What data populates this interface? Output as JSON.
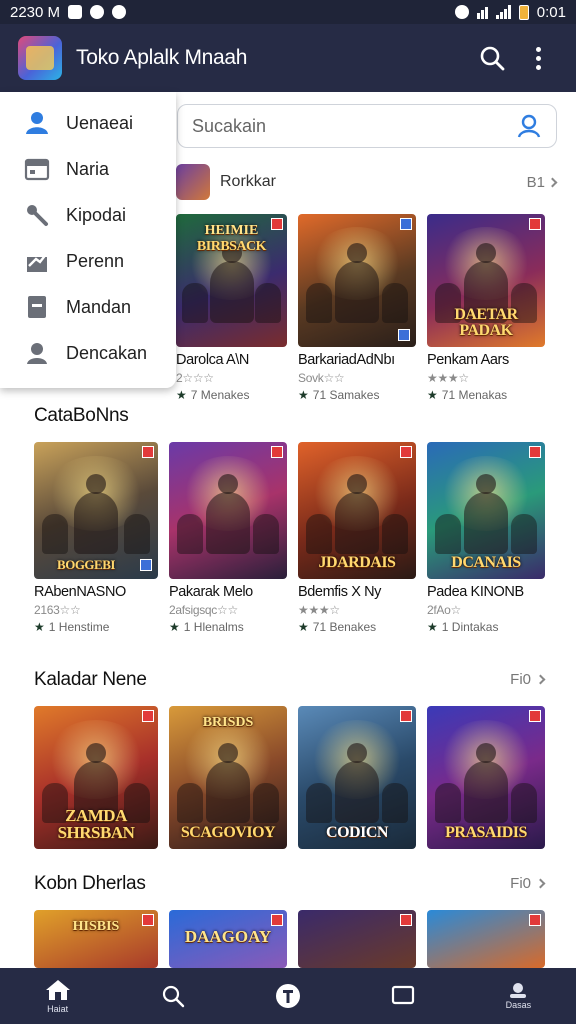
{
  "status": {
    "time": "2230 M",
    "right_time": "0:01"
  },
  "app": {
    "title": "Toko Aplalk Mnaah"
  },
  "colors": {
    "appbar": "#262b45",
    "accent": "#2f7de0"
  },
  "drawer": {
    "items": [
      {
        "label": "Uenaeai",
        "icon": "user-icon"
      },
      {
        "label": "Naria",
        "icon": "calendar-icon"
      },
      {
        "label": "Kipodai",
        "icon": "wrench-icon"
      },
      {
        "label": "Perenn",
        "icon": "chart-icon"
      },
      {
        "label": "Mandan",
        "icon": "document-icon"
      },
      {
        "label": "Dencakan",
        "icon": "person-icon"
      }
    ]
  },
  "search": {
    "placeholder": "Sucakain"
  },
  "featured": {
    "label": "Rorkkar",
    "more": "B1"
  },
  "top_cards": [
    {
      "name": "Darolca A\\N",
      "stars": "2☆☆☆",
      "meta": "7 Menakes",
      "logo": "BIRBSACK",
      "logo_top": "HEIMIE"
    },
    {
      "name": "BarkariadAdNbı",
      "stars": "Sovk☆☆",
      "meta": "71 Samakes",
      "logo": ""
    },
    {
      "name": "Penkam Aars",
      "stars": "★★★☆",
      "meta": "71 Menakas",
      "logo": "DAETAR PADAK",
      "logo_top": ""
    }
  ],
  "sections": [
    {
      "title": "CataBoNns",
      "more": ""
    },
    {
      "title": "Kaladar Nene",
      "more": "Fi0"
    },
    {
      "title": "Kobn Dherlas",
      "more": "Fi0"
    }
  ],
  "cat_cards": [
    {
      "name": "RAbenNASNO",
      "stars": "2163☆☆",
      "meta": "1 Henstime",
      "logo": "BOGGEBI"
    },
    {
      "name": "Pakarak Melo",
      "stars": "2afsigsqc☆☆",
      "meta": "1 Hlenalms",
      "logo": ""
    },
    {
      "name": "Bdemfis X Ny",
      "stars": "★★★☆",
      "meta": "71 Benakes",
      "logo": "JDARDAIS"
    },
    {
      "name": "Padea KINONB",
      "stars": "2fAo☆",
      "meta": "1 Dintakas",
      "logo": "DCANAIS"
    }
  ],
  "kal_cards": [
    {
      "logo": "ZAMDA SHRSBAN",
      "logo_top": ""
    },
    {
      "logo": "SCAGOVIOY",
      "logo_top": "BRISDS"
    },
    {
      "logo": "CODICN",
      "logo_top": ""
    },
    {
      "logo": "PRASAIDIS",
      "logo_top": ""
    }
  ],
  "kob_cards": [
    {
      "logo_top": "HISBIS"
    },
    {
      "logo_top": "DAAGOAY"
    },
    {
      "logo_top": ""
    },
    {
      "logo_top": ""
    }
  ],
  "bottom_nav": [
    {
      "label": "Haiat",
      "icon": "home-icon"
    },
    {
      "label": "",
      "icon": "search-icon"
    },
    {
      "label": "",
      "icon": "store-icon"
    },
    {
      "label": "",
      "icon": "chat-icon"
    },
    {
      "label": "Dasas",
      "icon": "profile-icon"
    }
  ]
}
